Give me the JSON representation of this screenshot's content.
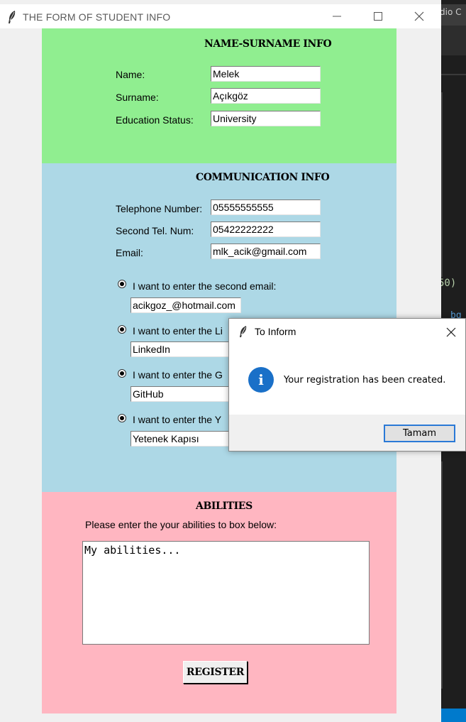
{
  "window": {
    "title": "THE FORM OF STUDENT INFO"
  },
  "background_editor": {
    "title_fragment": "dio C",
    "code_fragment_1": "50)",
    "code_fragment_2": "bg"
  },
  "name_section": {
    "heading": "NAME-SURNAME INFO",
    "fields": [
      {
        "label": "Name:",
        "value": "Melek"
      },
      {
        "label": "Surname:",
        "value": "Açıkgöz"
      },
      {
        "label": "Education Status:",
        "value": "University"
      }
    ],
    "color": "#90ee90"
  },
  "communication_section": {
    "heading": "COMMUNICATION INFO",
    "fields": [
      {
        "label": "Telephone Number:",
        "value": "05555555555"
      },
      {
        "label": "Second Tel. Num:",
        "value": "05422222222"
      },
      {
        "label": "Email:",
        "value": "mlk_acik@gmail.com"
      }
    ],
    "options": [
      {
        "label": "I want to enter the second email:",
        "value": "acikgoz_@hotmail.com",
        "selected": true
      },
      {
        "label": "I want to enter the Li",
        "value": "LinkedIn",
        "selected": true
      },
      {
        "label": "I want to enter the G",
        "value": "GitHub",
        "selected": true
      },
      {
        "label": "I want to enter the Y",
        "value": "Yetenek Kapısı",
        "selected": true
      }
    ],
    "color": "#add8e6"
  },
  "abilities_section": {
    "heading": "ABILITIES",
    "prompt": "Please enter the your abilities to box below:",
    "text": "My abilities...",
    "register_label": "REGISTER",
    "color": "#ffb6c1"
  },
  "dialog": {
    "title": "To Inform",
    "message": "Your registration has been created.",
    "ok_label": "Tamam",
    "icon": "info-icon"
  }
}
